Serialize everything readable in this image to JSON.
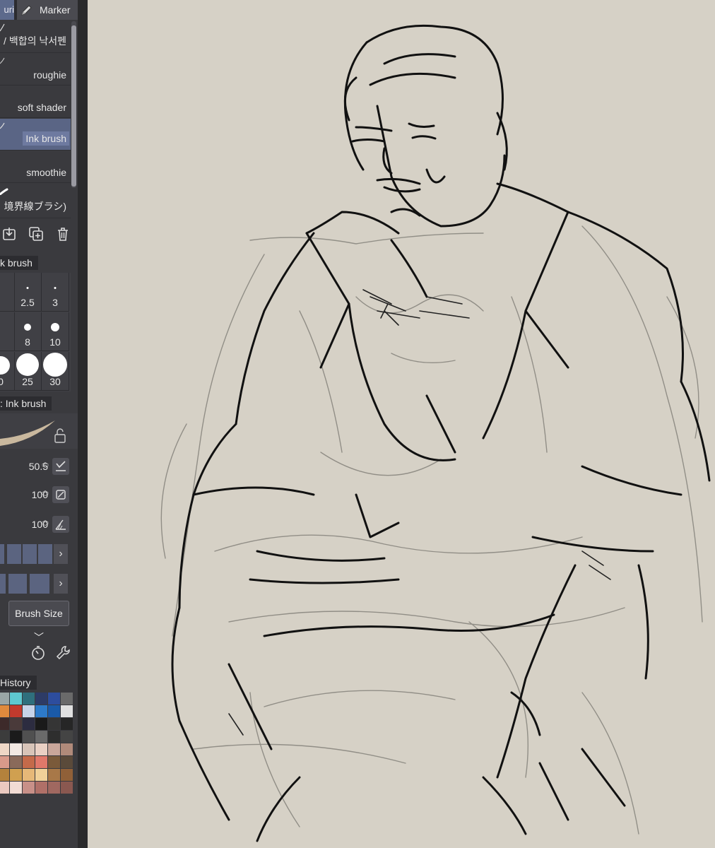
{
  "tabs": {
    "left_partial": "uri",
    "marker": "Marker"
  },
  "brush_list": {
    "items": [
      {
        "label": "/ 백합의 낙서펜",
        "selected": false
      },
      {
        "label": "roughie",
        "selected": false
      },
      {
        "label": "soft shader",
        "selected": false
      },
      {
        "label": "Ink brush",
        "selected": true
      },
      {
        "label": "smoothie",
        "selected": false
      },
      {
        "label": "境界線ブラシ)",
        "selected": false
      }
    ]
  },
  "brush_size_tab": "k brush",
  "brush_sizes": [
    {
      "label": "",
      "dot": 0
    },
    {
      "label": "2.5",
      "dot": 3
    },
    {
      "label": "3",
      "dot": 3
    },
    {
      "label": "",
      "dot": 0
    },
    {
      "label": "8",
      "dot": 10
    },
    {
      "label": "10",
      "dot": 12
    },
    {
      "label": "0",
      "dot": 26
    },
    {
      "label": "25",
      "dot": 32
    },
    {
      "label": "30",
      "dot": 34
    }
  ],
  "tool_property_tab": ": Ink brush",
  "properties": {
    "brush_size": "50.5",
    "opacity": "100",
    "anti_alias": "100"
  },
  "dropdown": {
    "label": "Brush Size"
  },
  "history_tab": "History",
  "colors": {
    "panel_bg": "#3a3a3e",
    "selection": "#5a6585",
    "canvas_bg": "#d6d1c6"
  },
  "palette": [
    "#3b3b3b",
    "#6d6d6d",
    "#9aa6a6",
    "#5ec8d0",
    "#2f6f7d",
    "#2d3b66",
    "#2d4d9e",
    "#6a6a6a",
    "#3f7a3e",
    "#cfb33a",
    "#e08a3d",
    "#c23a2d",
    "#c7d3e8",
    "#2d7ac9",
    "#1a5aa8",
    "#e0e0e0",
    "#1f1f1f",
    "#2b2b2b",
    "#3d2a2a",
    "#4a3a3a",
    "#2c2c40",
    "#1a1a1a",
    "#353535",
    "#262626",
    "#202020",
    "#2d2d2d",
    "#3c3c3c",
    "#1b1b1b",
    "#505050",
    "#6a6a6a",
    "#2e2e2e",
    "#444444",
    "#d2b79a",
    "#c7a789",
    "#eed7c6",
    "#f3e9e3",
    "#d8c4b8",
    "#ead0c4",
    "#c9a69a",
    "#b08a7a",
    "#a06060",
    "#c87a6a",
    "#d89a8a",
    "#8a6a5a",
    "#c46a4a",
    "#e0786a",
    "#7a5a3a",
    "#5a4a3a",
    "#c26d44",
    "#7a4a2c",
    "#b4823c",
    "#d0a050",
    "#e6b878",
    "#f0d098",
    "#a87848",
    "#906038",
    "#d7a6a0",
    "#e0bcb6",
    "#eac9c0",
    "#f2dcd4",
    "#c89088",
    "#b07068",
    "#a06860",
    "#8a5850"
  ]
}
